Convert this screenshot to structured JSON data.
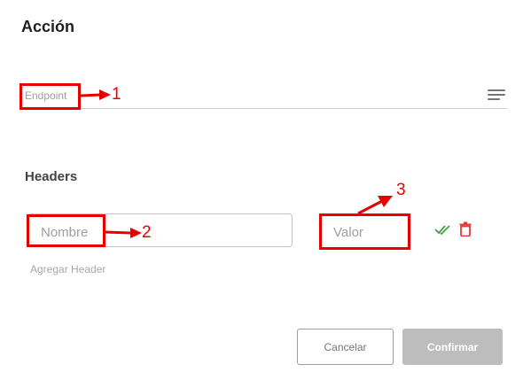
{
  "dialog": {
    "title": "Acción",
    "endpoint_placeholder": "Endpoint",
    "headers_title": "Headers",
    "header_name_placeholder": "Nombre",
    "header_value_placeholder": "Valor",
    "add_header_label": "Agregar Header",
    "cancel_label": "Cancelar",
    "confirm_label": "Confirmar"
  },
  "annotations": [
    "1",
    "2",
    "3"
  ],
  "icons": {
    "menu": "menu-lines-icon",
    "check": "double-check-icon",
    "delete": "trash-icon"
  },
  "colors": {
    "annotation": "#e60000",
    "check": "#43a047",
    "delete": "#e53935",
    "confirm_disabled": "#bdbdbd"
  }
}
